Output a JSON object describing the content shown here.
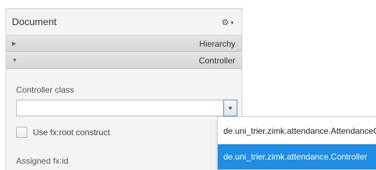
{
  "panel": {
    "title": "Document",
    "settings_icon": "gear-icon"
  },
  "sections": {
    "hierarchy": {
      "label": "Hierarchy",
      "state": "collapsed"
    },
    "controller": {
      "label": "Controller",
      "state": "expanded"
    }
  },
  "controller": {
    "class_label": "Controller class",
    "class_value": "",
    "fx_root_label": "Use fx:root construct",
    "fx_root_checked": false,
    "assigned_id_label": "Assigned fx:id"
  },
  "dropdown": {
    "options": [
      "de.uni_trier.zimk.attendance.AttendanceController",
      "de.uni_trier.zimk.attendance.Controller"
    ],
    "selected_index": 1
  },
  "colors": {
    "selection": "#1f8de6",
    "focus_border": "#3c8fe0"
  }
}
